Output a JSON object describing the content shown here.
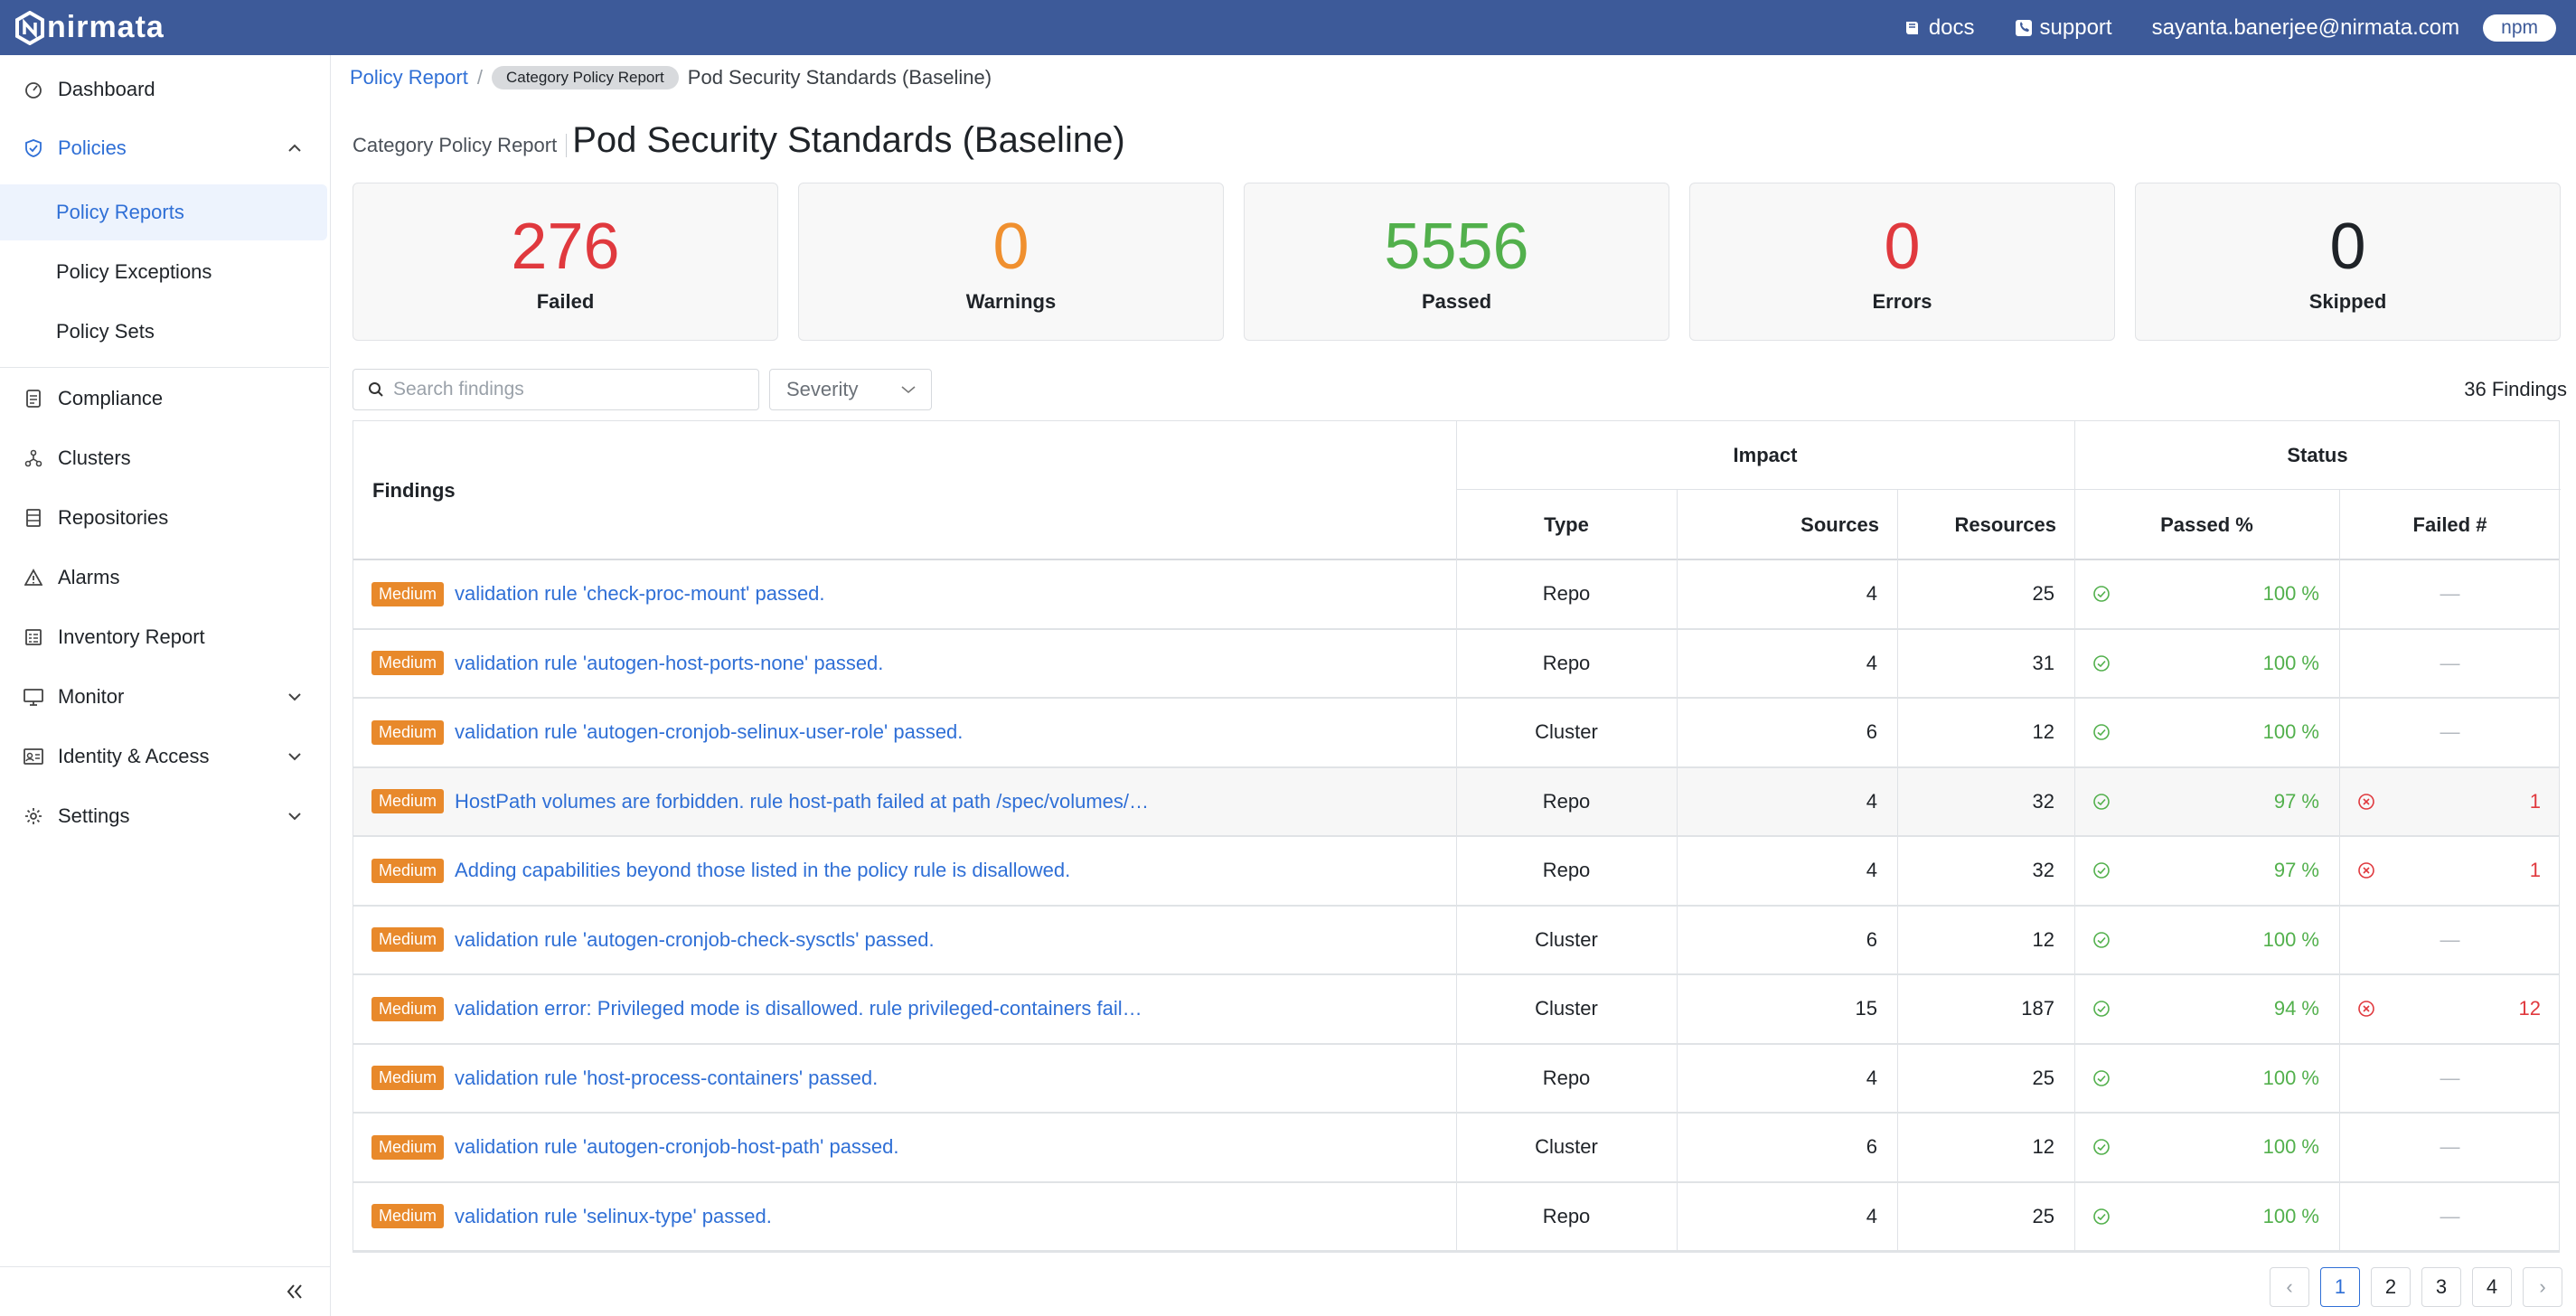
{
  "topbar": {
    "brand": "nirmata",
    "docs_label": "docs",
    "support_label": "support",
    "user_email": "sayanta.banerjee@nirmata.com",
    "tenant": "npm"
  },
  "sidebar": {
    "items": [
      {
        "label": "Dashboard",
        "icon": "dashboard-icon"
      },
      {
        "label": "Policies",
        "icon": "shield-icon"
      },
      {
        "label": "Compliance",
        "icon": "compliance-icon"
      },
      {
        "label": "Clusters",
        "icon": "clusters-icon"
      },
      {
        "label": "Repositories",
        "icon": "repositories-icon"
      },
      {
        "label": "Alarms",
        "icon": "alarm-icon"
      },
      {
        "label": "Inventory Report",
        "icon": "inventory-icon"
      },
      {
        "label": "Monitor",
        "icon": "monitor-icon"
      },
      {
        "label": "Identity & Access",
        "icon": "identity-icon"
      },
      {
        "label": "Settings",
        "icon": "gear-icon"
      }
    ],
    "policies_sub": [
      {
        "label": "Policy Reports"
      },
      {
        "label": "Policy Exceptions"
      },
      {
        "label": "Policy Sets"
      }
    ]
  },
  "breadcrumb": {
    "root": "Policy Report",
    "separator": "/",
    "chip": "Category Policy Report",
    "current": "Pod Security Standards (Baseline)"
  },
  "header": {
    "subtitle": "Category Policy Report",
    "title": "Pod Security Standards (Baseline)"
  },
  "stats": [
    {
      "value": "276",
      "label": "Failed",
      "color": "#e0393e"
    },
    {
      "value": "0",
      "label": "Warnings",
      "color": "#f0902f"
    },
    {
      "value": "5556",
      "label": "Passed",
      "color": "#52b04c"
    },
    {
      "value": "0",
      "label": "Errors",
      "color": "#e0393e"
    },
    {
      "value": "0",
      "label": "Skipped",
      "color": "#1f2328"
    }
  ],
  "filters": {
    "search_placeholder": "Search findings",
    "severity_label": "Severity",
    "findings_count": "36 Findings"
  },
  "table": {
    "headers": {
      "findings": "Findings",
      "impact": "Impact",
      "status": "Status",
      "type": "Type",
      "sources": "Sources",
      "resources": "Resources",
      "passed_pct": "Passed %",
      "failed_num": "Failed #"
    },
    "rows": [
      {
        "severity": "Medium",
        "finding": "validation rule 'check-proc-mount' passed.",
        "type": "Repo",
        "sources": "4",
        "resources": "25",
        "passed": "100 %",
        "failed": "—"
      },
      {
        "severity": "Medium",
        "finding": "validation rule 'autogen-host-ports-none' passed.",
        "type": "Repo",
        "sources": "4",
        "resources": "31",
        "passed": "100 %",
        "failed": "—"
      },
      {
        "severity": "Medium",
        "finding": "validation rule 'autogen-cronjob-selinux-user-role' passed.",
        "type": "Cluster",
        "sources": "6",
        "resources": "12",
        "passed": "100 %",
        "failed": "—"
      },
      {
        "severity": "Medium",
        "finding": "HostPath volumes are forbidden. rule host-path failed at path /spec/volumes/…",
        "type": "Repo",
        "sources": "4",
        "resources": "32",
        "passed": "97 %",
        "failed": "1"
      },
      {
        "severity": "Medium",
        "finding": "Adding capabilities beyond those listed in the policy rule is disallowed.",
        "type": "Repo",
        "sources": "4",
        "resources": "32",
        "passed": "97 %",
        "failed": "1"
      },
      {
        "severity": "Medium",
        "finding": "validation rule 'autogen-cronjob-check-sysctls' passed.",
        "type": "Cluster",
        "sources": "6",
        "resources": "12",
        "passed": "100 %",
        "failed": "—"
      },
      {
        "severity": "Medium",
        "finding": "validation error: Privileged mode is disallowed. rule privileged-containers fail…",
        "type": "Cluster",
        "sources": "15",
        "resources": "187",
        "passed": "94 %",
        "failed": "12"
      },
      {
        "severity": "Medium",
        "finding": "validation rule 'host-process-containers' passed.",
        "type": "Repo",
        "sources": "4",
        "resources": "25",
        "passed": "100 %",
        "failed": "—"
      },
      {
        "severity": "Medium",
        "finding": "validation rule 'autogen-cronjob-host-path' passed.",
        "type": "Cluster",
        "sources": "6",
        "resources": "12",
        "passed": "100 %",
        "failed": "—"
      },
      {
        "severity": "Medium",
        "finding": "validation rule 'selinux-type' passed.",
        "type": "Repo",
        "sources": "4",
        "resources": "25",
        "passed": "100 %",
        "failed": "—"
      }
    ]
  },
  "pagination": {
    "pages": [
      "1",
      "2",
      "3",
      "4"
    ],
    "current": "1",
    "prev": "‹",
    "next": "›"
  },
  "colors": {
    "brand": "#3d5a99",
    "link": "#2f6fd6",
    "badge": "#e8892b",
    "pass": "#52b04c",
    "fail": "#e0393e"
  }
}
